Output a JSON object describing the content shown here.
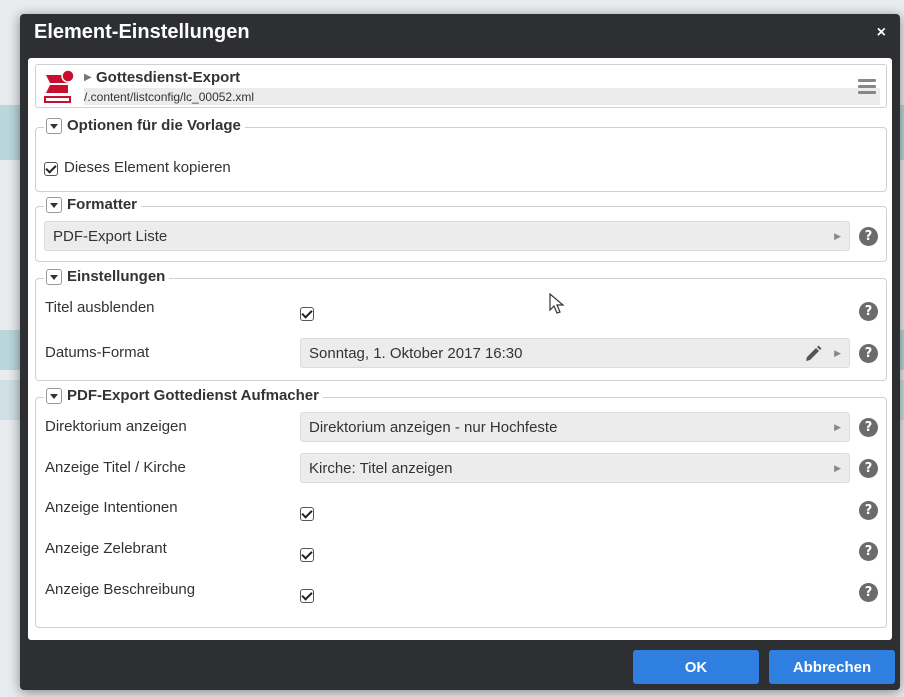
{
  "dialog": {
    "title": "Element-Einstellungen",
    "close_label": "×",
    "ok_label": "OK",
    "cancel_label": "Abbrechen"
  },
  "header": {
    "title": "Gottesdienst-Export",
    "path": "/.content/listconfig/lc_00052.xml",
    "icon": "export-document-icon"
  },
  "sections": {
    "options": {
      "legend": "Optionen für die Vorlage",
      "copy_label": "Dieses Element kopieren",
      "copy_checked": true
    },
    "formatter": {
      "legend": "Formatter",
      "value": "PDF-Export Liste"
    },
    "settings": {
      "legend": "Einstellungen",
      "hide_title_label": "Titel ausblenden",
      "hide_title_checked": true,
      "date_format_label": "Datums-Format",
      "date_format_value": "Sonntag, 1. Oktober 2017 16:30"
    },
    "pdf": {
      "legend": "PDF-Export Gottedienst Aufmacher",
      "directory_label": "Direktorium anzeigen",
      "directory_value": "Direktorium anzeigen - nur Hochfeste",
      "title_church_label": "Anzeige Titel / Kirche",
      "title_church_value": "Kirche: Titel anzeigen",
      "intentions_label": "Anzeige Intentionen",
      "intentions_checked": true,
      "celebrant_label": "Anzeige Zelebrant",
      "celebrant_checked": true,
      "description_label": "Anzeige Beschreibung",
      "description_checked": true
    }
  },
  "help_symbol": "?",
  "colors": {
    "dialog_bg": "#2d2f33",
    "button_blue": "#2f7fe0",
    "icon_red": "#c8102e"
  }
}
